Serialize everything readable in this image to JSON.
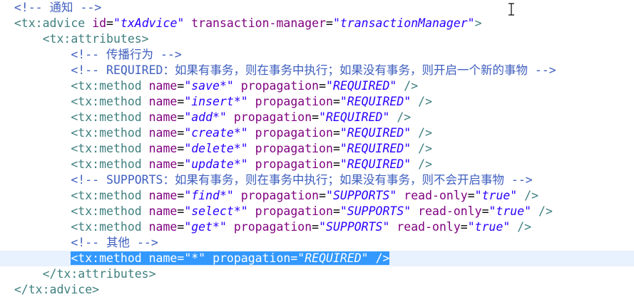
{
  "editor": {
    "lines": [
      {
        "indent": "  ",
        "tokens": [
          {
            "t": "comment",
            "v": "<!-- 通知 -->"
          }
        ]
      },
      {
        "indent": "  ",
        "tokens": [
          {
            "t": "tag",
            "v": "<tx:advice"
          },
          {
            "t": "punct",
            "v": " "
          },
          {
            "t": "attr",
            "v": "id"
          },
          {
            "t": "eq",
            "v": "="
          },
          {
            "t": "str",
            "v": "\"txAdvice\""
          },
          {
            "t": "punct",
            "v": " "
          },
          {
            "t": "attr",
            "v": "transaction-manager"
          },
          {
            "t": "eq",
            "v": "="
          },
          {
            "t": "str",
            "v": "\"transactionManager\""
          },
          {
            "t": "tag",
            "v": ">"
          }
        ]
      },
      {
        "indent": "      ",
        "tokens": [
          {
            "t": "tag",
            "v": "<tx:attributes>"
          }
        ]
      },
      {
        "indent": "          ",
        "tokens": [
          {
            "t": "comment",
            "v": "<!-- 传播行为 -->"
          }
        ]
      },
      {
        "indent": "          ",
        "tokens": [
          {
            "t": "comment",
            "v": "<!-- REQUIRED：如果有事务，则在事务中执行；如果没有事务，则开启一个新的事物 -->"
          }
        ]
      },
      {
        "indent": "          ",
        "tokens": [
          {
            "t": "tag",
            "v": "<tx:method"
          },
          {
            "t": "punct",
            "v": " "
          },
          {
            "t": "attr",
            "v": "name"
          },
          {
            "t": "eq",
            "v": "="
          },
          {
            "t": "str",
            "v": "\"save*\""
          },
          {
            "t": "punct",
            "v": " "
          },
          {
            "t": "attr",
            "v": "propagation"
          },
          {
            "t": "eq",
            "v": "="
          },
          {
            "t": "str",
            "v": "\"REQUIRED\""
          },
          {
            "t": "punct",
            "v": " "
          },
          {
            "t": "tag",
            "v": "/>"
          }
        ]
      },
      {
        "indent": "          ",
        "tokens": [
          {
            "t": "tag",
            "v": "<tx:method"
          },
          {
            "t": "punct",
            "v": " "
          },
          {
            "t": "attr",
            "v": "name"
          },
          {
            "t": "eq",
            "v": "="
          },
          {
            "t": "str",
            "v": "\"insert*\""
          },
          {
            "t": "punct",
            "v": " "
          },
          {
            "t": "attr",
            "v": "propagation"
          },
          {
            "t": "eq",
            "v": "="
          },
          {
            "t": "str",
            "v": "\"REQUIRED\""
          },
          {
            "t": "punct",
            "v": " "
          },
          {
            "t": "tag",
            "v": "/>"
          }
        ]
      },
      {
        "indent": "          ",
        "tokens": [
          {
            "t": "tag",
            "v": "<tx:method"
          },
          {
            "t": "punct",
            "v": " "
          },
          {
            "t": "attr",
            "v": "name"
          },
          {
            "t": "eq",
            "v": "="
          },
          {
            "t": "str",
            "v": "\"add*\""
          },
          {
            "t": "punct",
            "v": " "
          },
          {
            "t": "attr",
            "v": "propagation"
          },
          {
            "t": "eq",
            "v": "="
          },
          {
            "t": "str",
            "v": "\"REQUIRED\""
          },
          {
            "t": "punct",
            "v": " "
          },
          {
            "t": "tag",
            "v": "/>"
          }
        ]
      },
      {
        "indent": "          ",
        "tokens": [
          {
            "t": "tag",
            "v": "<tx:method"
          },
          {
            "t": "punct",
            "v": " "
          },
          {
            "t": "attr",
            "v": "name"
          },
          {
            "t": "eq",
            "v": "="
          },
          {
            "t": "str",
            "v": "\"create*\""
          },
          {
            "t": "punct",
            "v": " "
          },
          {
            "t": "attr",
            "v": "propagation"
          },
          {
            "t": "eq",
            "v": "="
          },
          {
            "t": "str",
            "v": "\"REQUIRED\""
          },
          {
            "t": "punct",
            "v": " "
          },
          {
            "t": "tag",
            "v": "/>"
          }
        ]
      },
      {
        "indent": "          ",
        "tokens": [
          {
            "t": "tag",
            "v": "<tx:method"
          },
          {
            "t": "punct",
            "v": " "
          },
          {
            "t": "attr",
            "v": "name"
          },
          {
            "t": "eq",
            "v": "="
          },
          {
            "t": "str",
            "v": "\"delete*\""
          },
          {
            "t": "punct",
            "v": " "
          },
          {
            "t": "attr",
            "v": "propagation"
          },
          {
            "t": "eq",
            "v": "="
          },
          {
            "t": "str",
            "v": "\"REQUIRED\""
          },
          {
            "t": "punct",
            "v": " "
          },
          {
            "t": "tag",
            "v": "/>"
          }
        ]
      },
      {
        "indent": "          ",
        "tokens": [
          {
            "t": "tag",
            "v": "<tx:method"
          },
          {
            "t": "punct",
            "v": " "
          },
          {
            "t": "attr",
            "v": "name"
          },
          {
            "t": "eq",
            "v": "="
          },
          {
            "t": "str",
            "v": "\"update*\""
          },
          {
            "t": "punct",
            "v": " "
          },
          {
            "t": "attr",
            "v": "propagation"
          },
          {
            "t": "eq",
            "v": "="
          },
          {
            "t": "str",
            "v": "\"REQUIRED\""
          },
          {
            "t": "punct",
            "v": " "
          },
          {
            "t": "tag",
            "v": "/>"
          }
        ]
      },
      {
        "indent": "          ",
        "tokens": [
          {
            "t": "comment",
            "v": "<!-- SUPPORTS：如果有事务，则在事务中执行；如果没有事务，则不会开启事物 -->"
          }
        ]
      },
      {
        "indent": "          ",
        "tokens": [
          {
            "t": "tag",
            "v": "<tx:method"
          },
          {
            "t": "punct",
            "v": " "
          },
          {
            "t": "attr",
            "v": "name"
          },
          {
            "t": "eq",
            "v": "="
          },
          {
            "t": "str",
            "v": "\"find*\""
          },
          {
            "t": "punct",
            "v": " "
          },
          {
            "t": "attr",
            "v": "propagation"
          },
          {
            "t": "eq",
            "v": "="
          },
          {
            "t": "str",
            "v": "\"SUPPORTS\""
          },
          {
            "t": "punct",
            "v": " "
          },
          {
            "t": "attr",
            "v": "read-only"
          },
          {
            "t": "eq",
            "v": "="
          },
          {
            "t": "str",
            "v": "\"true\""
          },
          {
            "t": "punct",
            "v": " "
          },
          {
            "t": "tag",
            "v": "/>"
          }
        ]
      },
      {
        "indent": "          ",
        "tokens": [
          {
            "t": "tag",
            "v": "<tx:method"
          },
          {
            "t": "punct",
            "v": " "
          },
          {
            "t": "attr",
            "v": "name"
          },
          {
            "t": "eq",
            "v": "="
          },
          {
            "t": "str",
            "v": "\"select*\""
          },
          {
            "t": "punct",
            "v": " "
          },
          {
            "t": "attr",
            "v": "propagation"
          },
          {
            "t": "eq",
            "v": "="
          },
          {
            "t": "str",
            "v": "\"SUPPORTS\""
          },
          {
            "t": "punct",
            "v": " "
          },
          {
            "t": "attr",
            "v": "read-only"
          },
          {
            "t": "eq",
            "v": "="
          },
          {
            "t": "str",
            "v": "\"true\""
          },
          {
            "t": "punct",
            "v": " "
          },
          {
            "t": "tag",
            "v": "/>"
          }
        ]
      },
      {
        "indent": "          ",
        "tokens": [
          {
            "t": "tag",
            "v": "<tx:method"
          },
          {
            "t": "punct",
            "v": " "
          },
          {
            "t": "attr",
            "v": "name"
          },
          {
            "t": "eq",
            "v": "="
          },
          {
            "t": "str",
            "v": "\"get*\""
          },
          {
            "t": "punct",
            "v": " "
          },
          {
            "t": "attr",
            "v": "propagation"
          },
          {
            "t": "eq",
            "v": "="
          },
          {
            "t": "str",
            "v": "\"SUPPORTS\""
          },
          {
            "t": "punct",
            "v": " "
          },
          {
            "t": "attr",
            "v": "read-only"
          },
          {
            "t": "eq",
            "v": "="
          },
          {
            "t": "str",
            "v": "\"true\""
          },
          {
            "t": "punct",
            "v": " "
          },
          {
            "t": "tag",
            "v": "/>"
          }
        ]
      },
      {
        "indent": "          ",
        "tokens": [
          {
            "t": "comment",
            "v": "<!-- 其他 -->"
          }
        ]
      },
      {
        "indent": "          ",
        "current": true,
        "selected": true,
        "tokens": [
          {
            "t": "tag",
            "v": "<tx:method"
          },
          {
            "t": "punct",
            "v": " "
          },
          {
            "t": "attr",
            "v": "name"
          },
          {
            "t": "eq",
            "v": "="
          },
          {
            "t": "str",
            "v": "\"*\""
          },
          {
            "t": "punct",
            "v": " "
          },
          {
            "t": "attr",
            "v": "propagation"
          },
          {
            "t": "eq",
            "v": "="
          },
          {
            "t": "str",
            "v": "\"REQUIRED\""
          },
          {
            "t": "punct",
            "v": " "
          },
          {
            "t": "tag",
            "v": "/>"
          }
        ]
      },
      {
        "indent": "      ",
        "tokens": [
          {
            "t": "tag",
            "v": "</tx:attributes>"
          }
        ]
      },
      {
        "indent": "  ",
        "tokens": [
          {
            "t": "tag",
            "v": "</tx:advice>"
          }
        ]
      }
    ]
  },
  "colors": {
    "tag": "#3f7f7f",
    "attr": "#7f007f",
    "string": "#2a00ff",
    "comment": "#3f5fbf",
    "selection": "#3399ff",
    "current_line": "#e8f2fe"
  },
  "cursor": {
    "icon": "ibeam-cursor-icon"
  }
}
